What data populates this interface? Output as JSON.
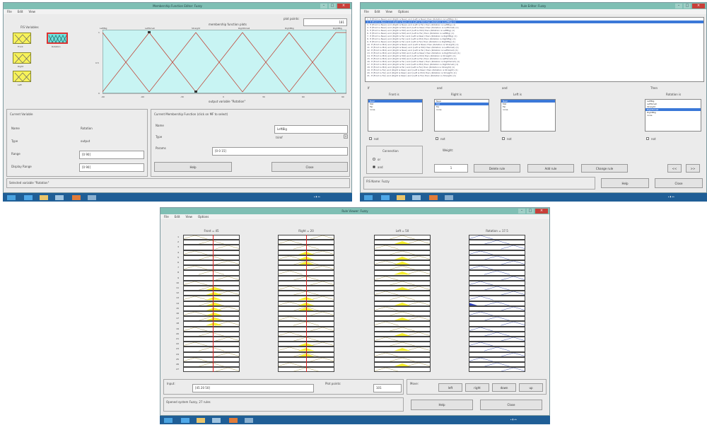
{
  "mf_editor": {
    "title": "Membership Function Editor: Fuzzy",
    "menus": [
      "File",
      "Edit",
      "View"
    ],
    "fis_variables_label": "FIS Variables",
    "variables": [
      "Front",
      "Right",
      "Left",
      "Rotation"
    ],
    "plot_points_label": "plot points:",
    "plot_points_value": "181",
    "plot_title": "membership function plots",
    "mf_labels": [
      "LeftBig",
      "LeftSmall",
      "Straight",
      "RightSmall",
      "RightBig",
      "RightBig"
    ],
    "x_ticks": [
      "-90",
      "-60",
      "-30",
      "0",
      "30",
      "60",
      "90"
    ],
    "y_ticks": [
      "1",
      "0.5",
      "0"
    ],
    "xlabel": "output variable \"Rotation\"",
    "current_variable_title": "Current Variable",
    "name_label": "Name",
    "name_value": "Rotation",
    "type_label": "Type",
    "type_value": "output",
    "range_label": "Range",
    "range_value": "[0 90]",
    "display_range_label": "Display Range",
    "display_range_value": "[0 90]",
    "current_mf_title": "Current Membership Function (click on MF to select)",
    "mf_name_label": "Name",
    "mf_name_value": "LeftBig",
    "mf_type_label": "Type",
    "mf_type_value": "trimf",
    "mf_params_label": "Params",
    "mf_params_value": "[0 0 15]",
    "help_label": "Help",
    "close_label": "Close",
    "status": "Selected variable \"Rotation\""
  },
  "rule_editor": {
    "title": "Rule Editor: Fuzzy",
    "menus": [
      "File",
      "Edit",
      "View",
      "Options"
    ],
    "rules": [
      "1. If (Front is Near) and (Right is Near) and (Left is Near) then (Rotation is LeftBig) (1)",
      "2. If (Front is Near) and (Right is Near) and (Left is Mid) then (Rotation is LeftBig) (1)",
      "3. If (Front is Near) and (Right is Near) and (Left is Far) then (Rotation is LeftBig) (1)",
      "4. If (Front is Near) and (Right is Mid) and (Left is Near) then (Rotation is LeftSmall) (1)",
      "5. If (Front is Near) and (Right is Mid) and (Left is Mid) then (Rotation is LeftBig) (1)",
      "6. If (Front is Near) and (Right is Mid) and (Left is Far) then (Rotation is LeftBig) (1)",
      "7. If (Front is Near) and (Right is Far) and (Left is Near) then (Rotation is RightBig) (1)",
      "8. If (Front is Near) and (Right is Far) and (Left is Mid) then (Rotation is RightBig) (1)",
      "9. If (Front is Near) and (Right is Far) and (Left is Far) then (Rotation is RightBig) (1)",
      "10. If (Front is Mid) and (Right is Near) and (Left is Near) then (Rotation is Straight) (1)",
      "11. If (Front is Mid) and (Right is Near) and (Left is Mid) then (Rotation is LeftSmall) (1)",
      "12. If (Front is Mid) and (Right is Near) and (Left is Far) then (Rotation is LeftSmall) (1)",
      "13. If (Front is Mid) and (Right is Mid) and (Left is Near) then (Rotation is RightSmall) (1)",
      "14. If (Front is Mid) and (Right is Mid) and (Left is Mid) then (Rotation is Straight) (1)",
      "15. If (Front is Mid) and (Right is Mid) and (Left is Far) then (Rotation is LeftSmall) (1)",
      "16. If (Front is Mid) and (Right is Far) and (Left is Near) then (Rotation is RightSmall) (1)",
      "17. If (Front is Mid) and (Right is Far) and (Left is Mid) then (Rotation is RightSmall) (1)",
      "18. If (Front is Mid) and (Right is Far) and (Left is Far) then (Rotation is Straight) (1)",
      "19. If (Front is Far) and (Right is Near) and (Left is Near) then (Rotation is Straight) (1)",
      "20. If (Front is Far) and (Right is Near) and (Left is Mid) then (Rotation is Straight) (1)",
      "21. If (Front is Far) and (Right is Near) and (Left is Far) then (Rotation is Straight) (1)"
    ],
    "if_label": "If",
    "and1_label": "and",
    "and2_label": "and",
    "then_label": "Then",
    "col_front": "Front is",
    "col_right": "Right is",
    "col_left": "Left is",
    "col_rotation": "Rotation is",
    "front_items": [
      "Near",
      "Mid",
      "Far",
      "none"
    ],
    "right_items": [
      "Near",
      "Mid",
      "Far",
      "none"
    ],
    "left_items": [
      "Near",
      "Mid",
      "Far",
      "none"
    ],
    "rotation_items": [
      "LeftBig",
      "LeftSmall",
      "Straight",
      "RightSmall",
      "RightBig",
      "none"
    ],
    "not_label": "not",
    "connection_label": "Connection",
    "or_label": "or",
    "and_label": "and",
    "weight_label": "Weight:",
    "weight_value": "1",
    "delete_rule": "Delete rule",
    "add_rule": "Add rule",
    "change_rule": "Change rule",
    "prev_label": "<<",
    "next_label": ">>",
    "status": "FIS Name: Fuzzy",
    "help_label": "Help",
    "close_label": "Close"
  },
  "rule_viewer": {
    "title": "Rule Viewer: Fuzzy",
    "menus": [
      "File",
      "Edit",
      "View",
      "Options"
    ],
    "col_headers": [
      "Front = 45",
      "Right = 20",
      "Left = 50",
      "Rotation = 17.5"
    ],
    "input_label": "Input:",
    "input_value": "[45 20 50]",
    "plot_points_label": "Plot points:",
    "plot_points_value": "101",
    "move_label": "Move:",
    "left_label": "left",
    "right_label": "right",
    "down_label": "down",
    "up_label": "up",
    "status": "Opened system Fuzzy, 27 rules",
    "help_label": "Help",
    "close_label": "Close"
  },
  "colors": {
    "titlebar": "#7fbfb4",
    "plot_bg": "#c8f4f3",
    "mf_line": "#c0392b",
    "variable_box": "#f7f25a",
    "selected_variable": "#6fe3e0",
    "selection_blue": "#3b78d8",
    "taskbar": "#1f5e96",
    "rule_fill": "#f5ee2d"
  }
}
